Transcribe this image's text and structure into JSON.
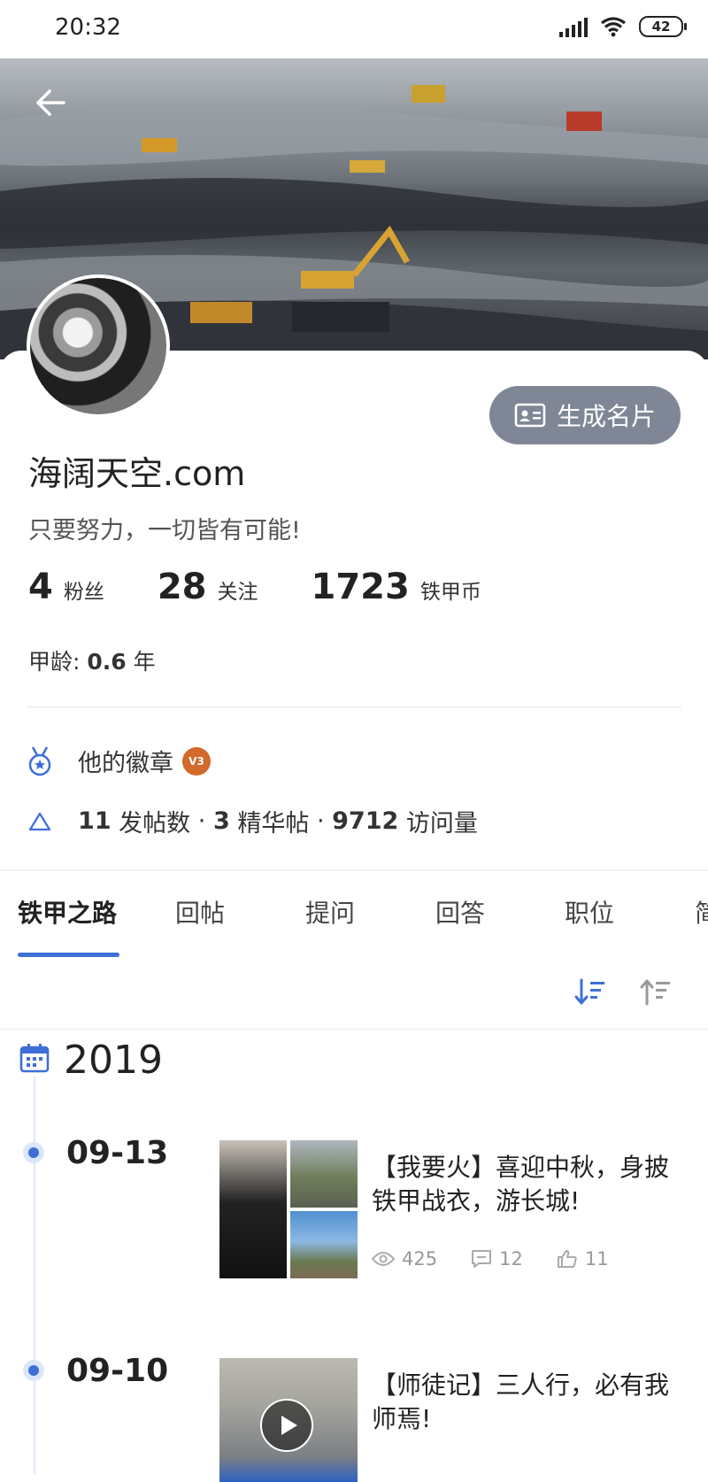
{
  "status_bar": {
    "time": "20:32",
    "battery": "42"
  },
  "profile": {
    "name": "海阔天空.com",
    "bio": "只要努力，一切皆有可能!",
    "generate_card_label": "生成名片",
    "stats": [
      {
        "num": "4",
        "label": "粉丝"
      },
      {
        "num": "28",
        "label": "关注"
      },
      {
        "num": "1723",
        "label": "铁甲币"
      }
    ],
    "age_prefix": "甲龄:",
    "age_value": "0.6",
    "age_unit": "年",
    "badges_label": "他的徽章",
    "badge_text": "V3",
    "counts": {
      "posts_num": "11",
      "posts_label": "发帖数",
      "featured_num": "3",
      "featured_label": "精华帖",
      "views_num": "9712",
      "views_label": "访问量",
      "dot": "·"
    }
  },
  "tabs": [
    {
      "label": "铁甲之路",
      "active": true
    },
    {
      "label": "回帖"
    },
    {
      "label": "提问"
    },
    {
      "label": "回答"
    },
    {
      "label": "职位"
    },
    {
      "label": "简"
    }
  ],
  "timeline": {
    "year": "2019",
    "entries": [
      {
        "date": "09-13",
        "title": "【我要火】喜迎中秋，身披铁甲战衣，游长城!",
        "views": "425",
        "comments": "12",
        "likes": "11"
      },
      {
        "date": "09-10",
        "title": "【师徒记】三人行，必有我师焉!"
      }
    ]
  },
  "colors": {
    "accent": "#3d6fd6",
    "card_button": "#7f8796"
  }
}
